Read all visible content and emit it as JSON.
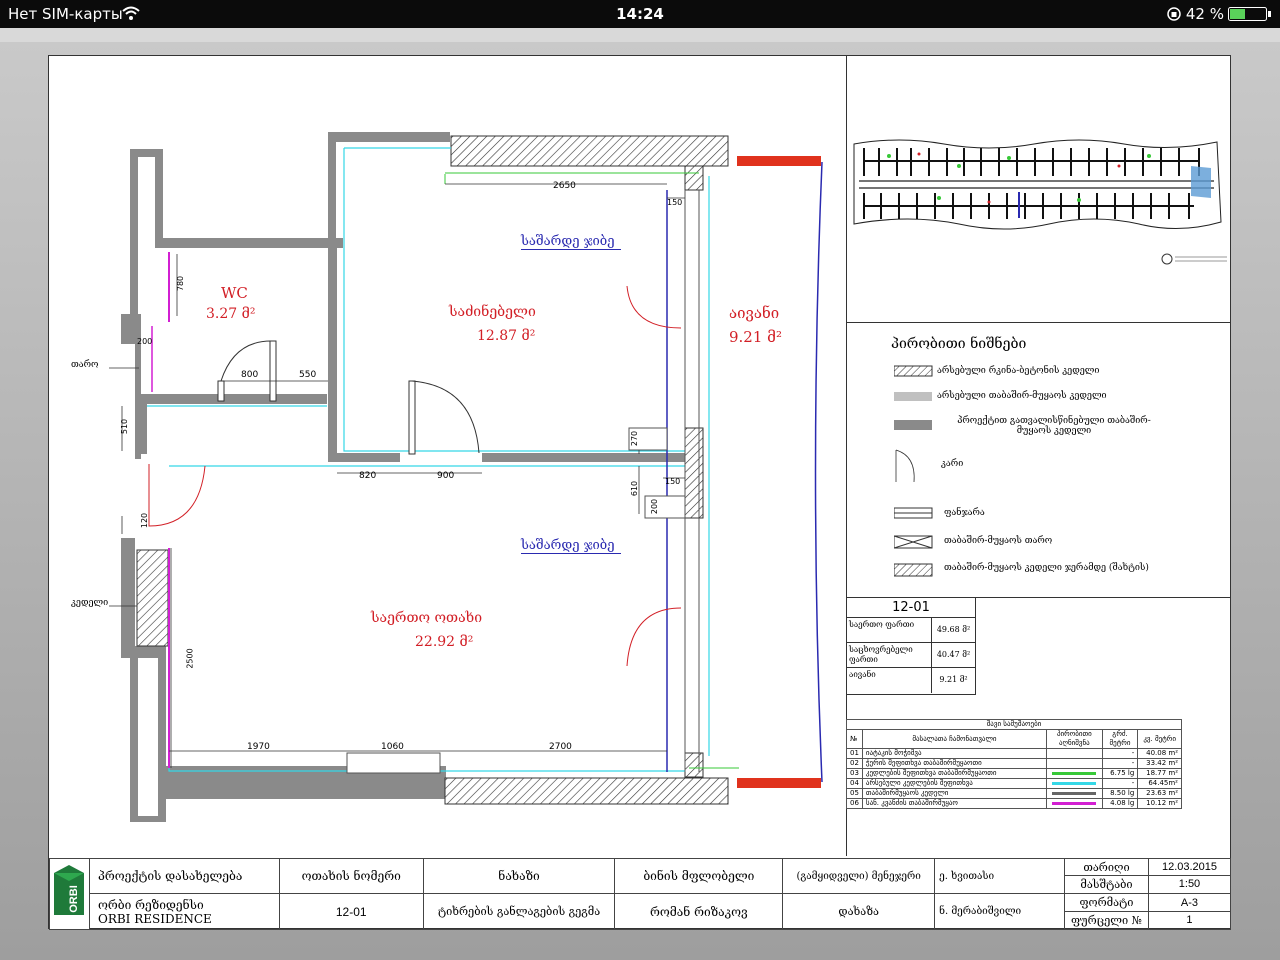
{
  "status_bar": {
    "carrier": "Нет SIM-карты",
    "time": "14:24",
    "battery": "42 %"
  },
  "plan": {
    "rooms": [
      {
        "name": "WC",
        "area": "3.27  მ²"
      },
      {
        "name": "საძინებელი",
        "area": "12.87  მ²"
      },
      {
        "name": "აივანი",
        "area": "9.21  მ²"
      },
      {
        "name": "საერთო ოთახი",
        "area": "22.92  მ²"
      }
    ],
    "wardrobe_label": "საშარდე ჯიბე",
    "side_labels": {
      "door": "თარო",
      "wall": "კედელი"
    },
    "dimensions": {
      "d2650": "2650",
      "d150a": "150",
      "d780": "780",
      "d200a": "200",
      "d800": "800",
      "d550": "550",
      "d510": "510",
      "d820": "820",
      "d900": "900",
      "d270": "270",
      "d610": "610",
      "d150b": "150",
      "d200b": "200",
      "d120": "120",
      "d2500": "2500",
      "d1970": "1970",
      "d1060": "1060",
      "d2700": "2700"
    }
  },
  "legend": {
    "title": "პირობითი ნიშნები",
    "items": [
      "არსებული რკინა-ბეტონის კედელი",
      "არსებული თაბაშირ-მუყაოს კედელი",
      "პროექტით გათვალისწინებული თაბაშირ-მუყაოს კედელი",
      "კარი",
      "ფანჯარა",
      "თაბაშირ-მუყაოს თარო",
      "თაბაშირ-მუყაოს კედელი ჯერამდე (შახტის)"
    ]
  },
  "area_summary": {
    "apt": "12-01",
    "rows": [
      {
        "label": "საერთო ფართი",
        "value": "49.68  მ²"
      },
      {
        "label": "საცხოვრებელი ფართი",
        "value": "40.47  მ²"
      },
      {
        "label": "აივანი",
        "value": "9.21  მ²"
      }
    ]
  },
  "materials": {
    "title": "შავი სამუშაოები",
    "header": [
      "№",
      "მასალათა  ჩამონათვალი",
      "პირობითი აღნიშვნა",
      "გრძ. მეტრი",
      "კვ. მეტრი"
    ],
    "rows": [
      {
        "n": "01",
        "name": "იატაკის მოჭიმვა",
        "color": "",
        "lm": "-",
        "sqm": "40.08 m²"
      },
      {
        "n": "02",
        "name": "ჭერის შეფითხვა თაბაშირმუყაოთი",
        "color": "",
        "lm": "-",
        "sqm": "33.42 m²"
      },
      {
        "n": "03",
        "name": "კედლების შეფითხვა თაბაშირმუყაოთი",
        "color": "#37c837",
        "lm": "6.75 lg",
        "sqm": "18.77 m²"
      },
      {
        "n": "04",
        "name": "არსებული კედლების შეფითხვა",
        "color": "#34d7e6",
        "lm": "-",
        "sqm": "64.45m²"
      },
      {
        "n": "05",
        "name": "თაბაშირმუყაოს კედელი",
        "color": "#666666",
        "lm": "8.50 lg",
        "sqm": "23.63 m²"
      },
      {
        "n": "06",
        "name": "სან. კვანძის თაბაშირმუყაო",
        "color": "#d21fd2",
        "lm": "4.08 lg",
        "sqm": "10.12 m²"
      }
    ]
  },
  "title_block": {
    "logo": "ORBI",
    "project_label": "პროექტის დასახელება",
    "project_name_ka": "ორბი რეზიდენსი",
    "project_name_en": "ORBI RESIDENCE",
    "room_no_label": "ოთახის ნომერი",
    "room_no": "12-01",
    "drawing_label": "ნახაზი",
    "drawing_name": "ტიხრების განლაგების გეგმა",
    "owner_label": "ბინის მფლობელი",
    "owner_name": "რომან რიზაკოვ",
    "manager_label": "(გამყიდველი)  მენეჯერი",
    "drew_label": "დახაზა",
    "manager_name": "ე. ხვითასი",
    "drew_name": "ნ. მერაბიშვილი",
    "date_label": "თარიღი",
    "date": "12.03.2015",
    "scale_label": "მასშტაბი",
    "scale": "1:50",
    "format_label": "ფორმატი",
    "format": "A-3",
    "sheet_label": "ფურცელი №",
    "sheet": "1"
  },
  "colors": {
    "wall": "#8a8a8a",
    "red": "#d21f26",
    "blue": "#2a2ab0",
    "cyan": "#34d7e6",
    "green": "#37c837",
    "magenta": "#d21fd2"
  }
}
